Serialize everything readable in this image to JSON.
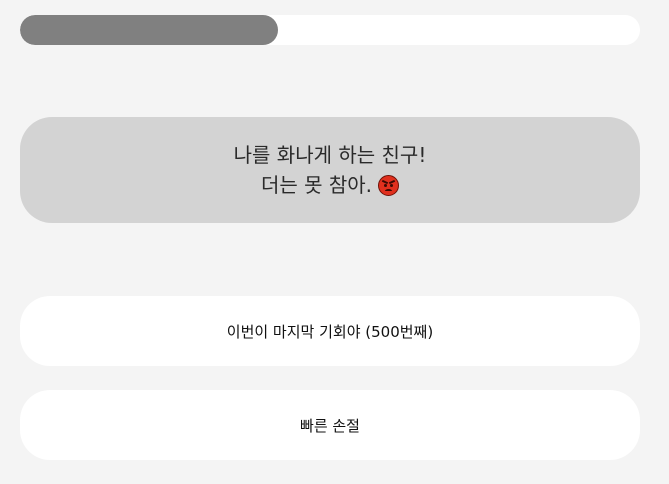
{
  "progress": {
    "fraction": 0.416,
    "fill_color": "#808080",
    "track_color": "#ffffff"
  },
  "question": {
    "line1": "나를 화나게 하는 친구!",
    "line2": "더는 못 참아.",
    "emoji_icon": "angry-face-icon"
  },
  "answers": [
    {
      "label": "이번이 마지막 기회야 (500번째)"
    },
    {
      "label": "빠른 손절"
    }
  ]
}
